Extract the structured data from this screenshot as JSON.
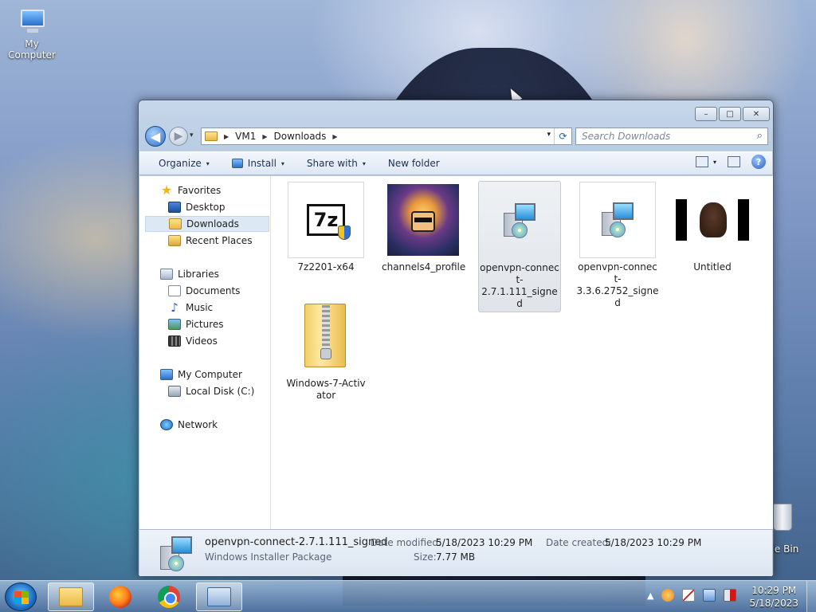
{
  "desktop": {
    "icons": [
      {
        "label": "My Computer",
        "icon": "computer-icon"
      },
      {
        "label": "cle Bin",
        "icon": "recycle-bin-icon"
      }
    ]
  },
  "window": {
    "caption_buttons": {
      "minimize": "–",
      "maximize": "□",
      "close": "✕"
    },
    "nav": {
      "back": "◀",
      "forward": "▶",
      "history": "▾"
    },
    "address": {
      "segments": [
        "VM1",
        "Downloads"
      ],
      "sep": "▶",
      "dropdown": "▾",
      "refresh": "⟳"
    },
    "search": {
      "placeholder": "Search Downloads",
      "icon": "⌕"
    },
    "commands": {
      "organize": "Organize",
      "install": "Install",
      "share_with": "Share with",
      "new_folder": "New folder",
      "arrow": "▾",
      "help": "?"
    },
    "nav_pane": {
      "favorites": "Favorites",
      "desktop": "Desktop",
      "downloads": "Downloads",
      "recent_places": "Recent Places",
      "libraries": "Libraries",
      "documents": "Documents",
      "music": "Music",
      "pictures": "Pictures",
      "videos": "Videos",
      "my_computer": "My Computer",
      "local_disk": "Local Disk (C:)",
      "network": "Network"
    },
    "files": [
      {
        "name": "7z2201-x64",
        "icon": "7zip-installer-icon",
        "selected": false
      },
      {
        "name": "channels4_profile",
        "icon": "image-thumbnail",
        "selected": false
      },
      {
        "name": "openvpn-connect-2.7.1.111_signed",
        "line1": "openvpn-connec",
        "line2": "t-2.7.1.111_signe",
        "line3": "d",
        "icon": "msi-installer-icon",
        "selected": true
      },
      {
        "name": "openvpn-connect-3.3.6.2752_signed",
        "line1": "openvpn-connec",
        "line2": "t-3.3.6.2752_signe",
        "line3": "d",
        "icon": "msi-installer-icon",
        "selected": false
      },
      {
        "name": "Untitled",
        "icon": "image-thumbnail",
        "selected": false
      },
      {
        "name": "Windows-7-Activator",
        "line1": "Windows-7-Activ",
        "line2": "ator",
        "icon": "zip-folder-icon",
        "selected": false
      }
    ],
    "details": {
      "name": "openvpn-connect-2.7.1.111_signed",
      "type": "Windows Installer Package",
      "date_modified_label": "Date modified:",
      "date_modified": "5/18/2023 10:29 PM",
      "date_created_label": "Date created:",
      "date_created": "5/18/2023 10:29 PM",
      "size_label": "Size:",
      "size": "7.77 MB"
    }
  },
  "taskbar": {
    "tray_arrow": "▲",
    "clock": {
      "time": "10:29 PM",
      "date": "5/18/2023"
    }
  }
}
